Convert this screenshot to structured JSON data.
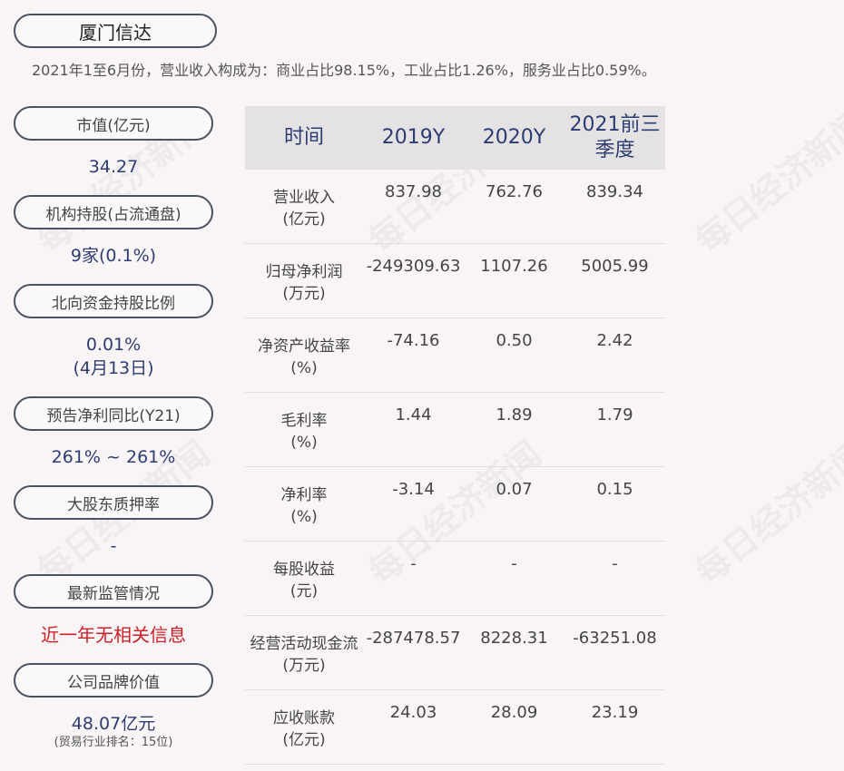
{
  "header": {
    "company": "厦门信达",
    "summary": "2021年1至6月份，营业收入构成为：商业占比98.15%，工业占比1.26%，服务业占比0.59%。"
  },
  "left_panel": [
    {
      "label": "市值(亿元)",
      "value": "34.27"
    },
    {
      "label": "机构持股(占流通盘)",
      "value": "9家(0.1%)"
    },
    {
      "label": "北向资金持股比例",
      "value": "0.01%",
      "value2": "(4月13日)"
    },
    {
      "label": "预告净利同比(Y21)",
      "value": "261% ~ 261%"
    },
    {
      "label": "大股东质押率",
      "value": "-"
    },
    {
      "label": "最新监管情况",
      "value": "近一年无相关信息"
    },
    {
      "label": "公司品牌价值",
      "value": "48.07亿元",
      "note": "(贸易行业排名：15位)"
    }
  ],
  "table": {
    "headers": [
      "时间",
      "2019Y",
      "2020Y",
      "2021前三季度"
    ],
    "rows": [
      {
        "label": "营业收入",
        "unit": "(亿元)",
        "values": [
          "837.98",
          "762.76",
          "839.34"
        ]
      },
      {
        "label": "归母净利润",
        "unit": "(万元)",
        "values": [
          "-249309.63",
          "1107.26",
          "5005.99"
        ]
      },
      {
        "label": "净资产收益率",
        "unit": "(%)",
        "values": [
          "-74.16",
          "0.50",
          "2.42"
        ]
      },
      {
        "label": "毛利率",
        "unit": "(%)",
        "values": [
          "1.44",
          "1.89",
          "1.79"
        ]
      },
      {
        "label": "净利率",
        "unit": "(%)",
        "values": [
          "-3.14",
          "0.07",
          "0.15"
        ]
      },
      {
        "label": "每股收益",
        "unit": "(元)",
        "values": [
          "-",
          "-",
          "-"
        ]
      },
      {
        "label": "经营活动现金流",
        "unit": "(万元)",
        "values": [
          "-287478.57",
          "8228.31",
          "-63251.08"
        ]
      },
      {
        "label": "应收账款",
        "unit": "(亿元)",
        "values": [
          "24.03",
          "28.09",
          "23.19"
        ]
      }
    ]
  },
  "watermark": "每日经济新闻"
}
